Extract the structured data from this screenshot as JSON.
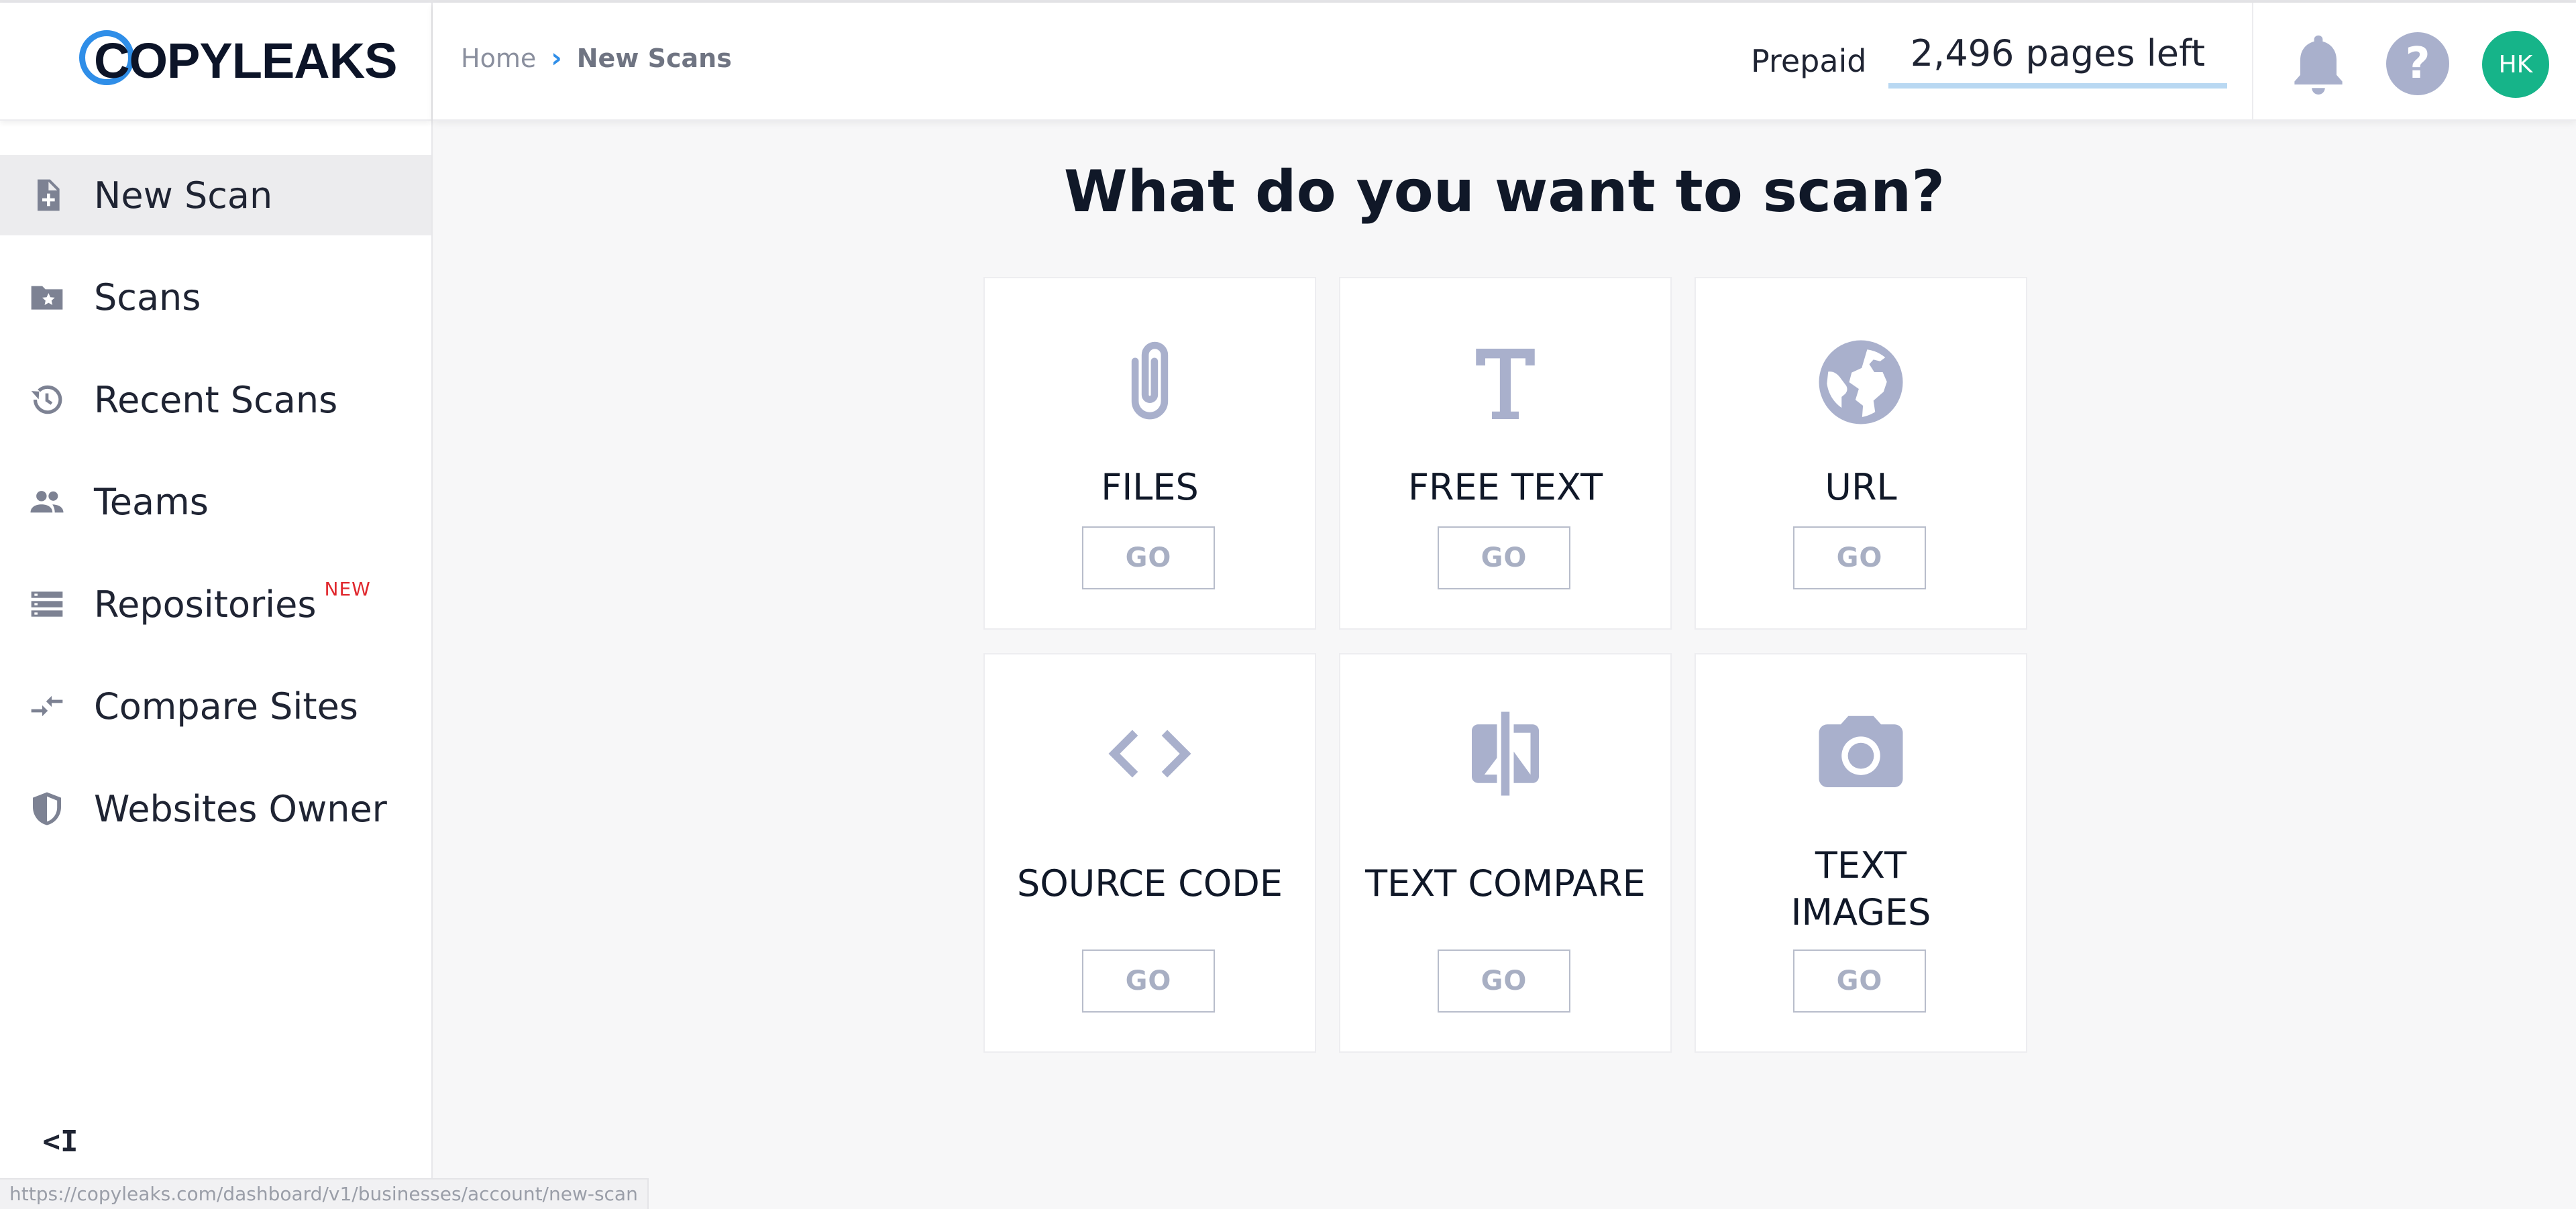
{
  "logo": {
    "text": "COPYLEAKS"
  },
  "breadcrumb": {
    "home": "Home",
    "separator": "›",
    "current": "New Scans"
  },
  "header": {
    "plan_label": "Prepaid",
    "pages_left": "2,496 pages left",
    "pages_left_fraction": 1.0,
    "help_symbol": "?",
    "avatar_initials": "HK",
    "icons": [
      "bell-icon",
      "help-icon"
    ]
  },
  "sidebar": {
    "items": [
      {
        "label": "New Scan",
        "icon": "new-file-icon",
        "active": true
      },
      {
        "label": "Scans",
        "icon": "starred-folder-icon"
      },
      {
        "label": "Recent Scans",
        "icon": "history-icon"
      },
      {
        "label": "Teams",
        "icon": "people-icon"
      },
      {
        "label": "Repositories",
        "icon": "storage-icon",
        "badge": "NEW"
      },
      {
        "label": "Compare Sites",
        "icon": "compare-arrows-icon"
      },
      {
        "label": "Websites Owner",
        "icon": "shield-icon"
      }
    ],
    "collapse_label": "<I"
  },
  "main": {
    "title": "What do you want to scan?",
    "cards": [
      {
        "label": "FILES",
        "button": "GO",
        "icon": "paperclip-icon"
      },
      {
        "label": "FREE TEXT",
        "button": "GO",
        "icon": "text-icon"
      },
      {
        "label": "URL",
        "button": "GO",
        "icon": "globe-icon"
      },
      {
        "label": "SOURCE CODE",
        "button": "GO",
        "icon": "code-icon"
      },
      {
        "label": "TEXT COMPARE",
        "button": "GO",
        "icon": "compare-icon"
      },
      {
        "label_line1": "TEXT",
        "label_line2": "IMAGES",
        "button": "GO",
        "icon": "camera-icon"
      }
    ]
  },
  "colors": {
    "accent": "#2f8ee8",
    "icon_gray": "#a9b0cc",
    "avatar_bg": "#16b489",
    "new_badge": "#e0282e"
  },
  "status_bar": {
    "url": "https://copyleaks.com/dashboard/v1/businesses/account/new-scan"
  }
}
